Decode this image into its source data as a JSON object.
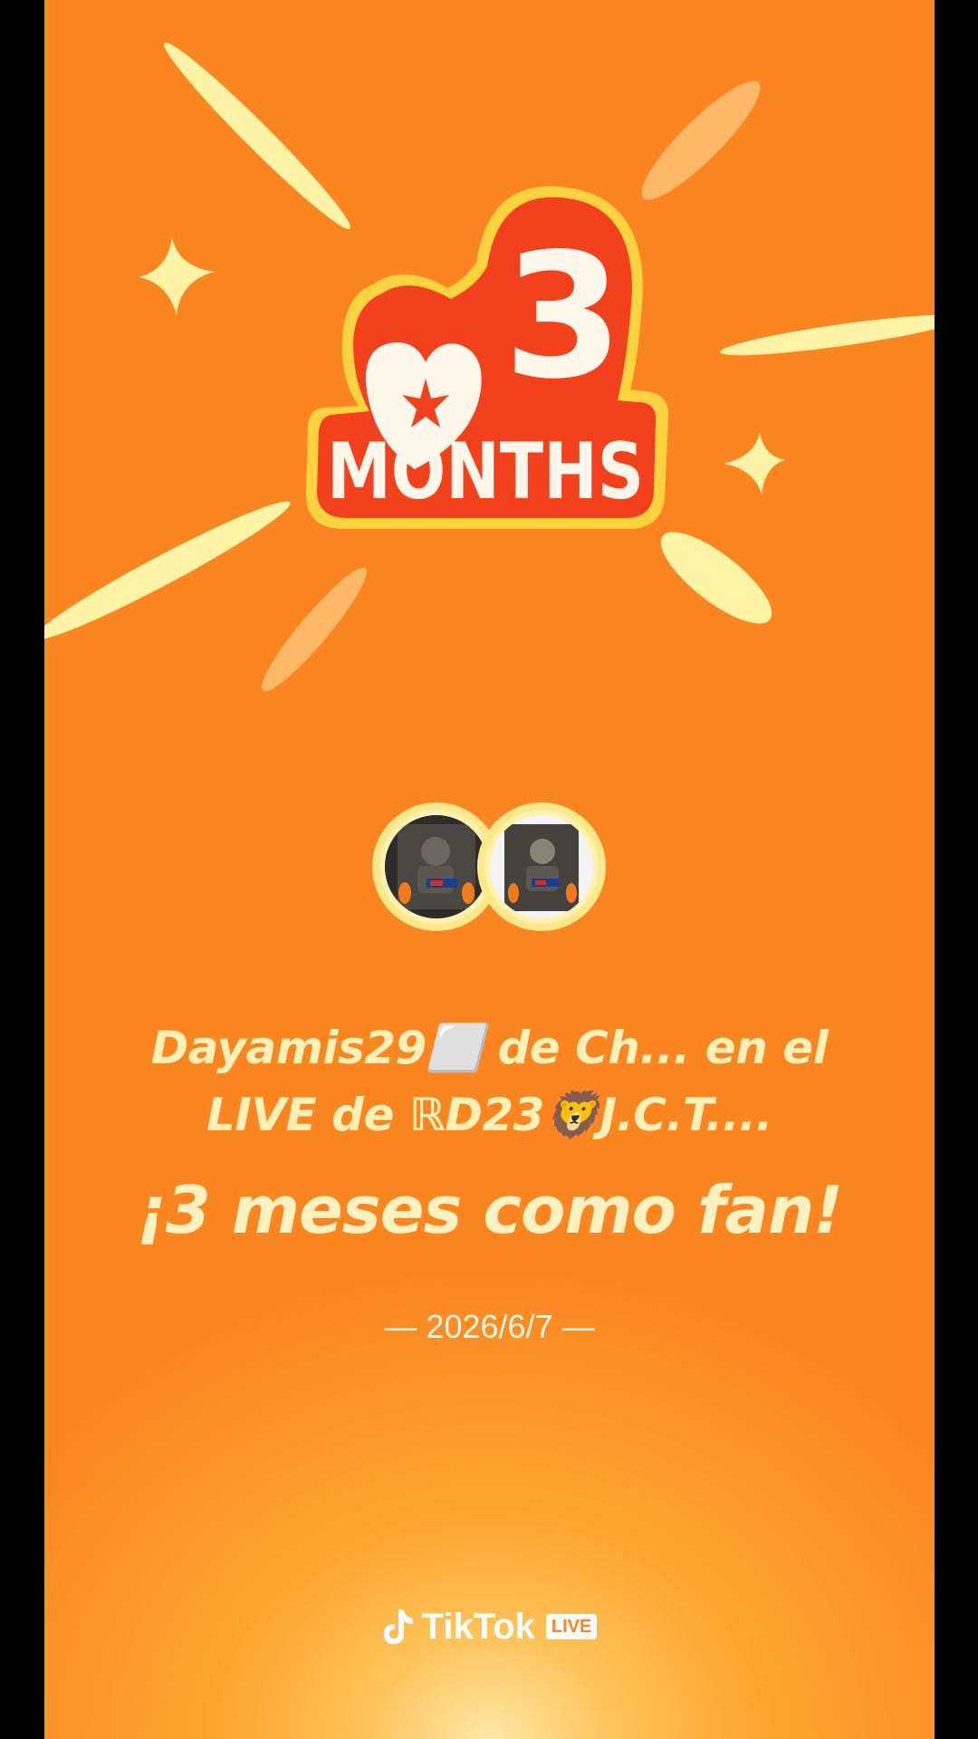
{
  "badge": {
    "number": "3",
    "word": "MONTHS"
  },
  "names": {
    "line1": "Dayamis29⬜ de Ch... en el",
    "line2": "LIVE de ℝD23🦁J.C.T...."
  },
  "headline": "¡3 meses como fan!",
  "date": "— 2026/6/7 —",
  "brand": {
    "name": "TikTok",
    "tag": "LIVE"
  },
  "colors": {
    "background": "#fb8521",
    "badge_red": "#f2411c",
    "badge_outline": "#ffd23f",
    "text_cream": "#fff0b5"
  },
  "icons": [
    "sparkle-icon",
    "tiktok-logo-icon"
  ]
}
